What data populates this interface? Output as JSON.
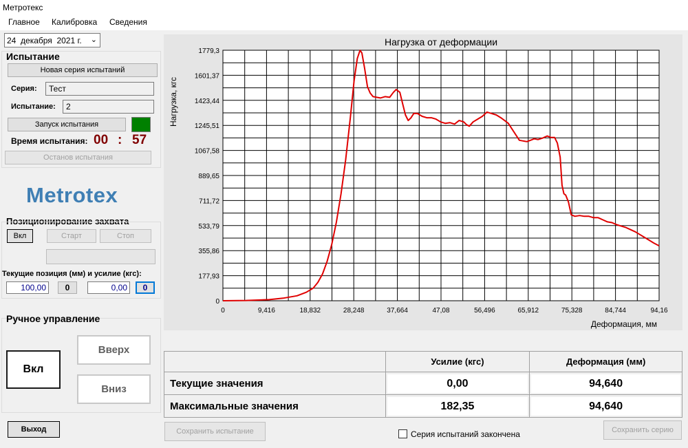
{
  "window": {
    "title": "Метротекс"
  },
  "menu": [
    "Главное",
    "Калибровка",
    "Сведения"
  ],
  "date": {
    "value": "24  декабря  2021 г."
  },
  "test": {
    "section_title": "Испытание",
    "new_series_button": "Новая серия испытаний",
    "series_label": "Серия:",
    "series_value": "Тест",
    "trial_label": "Испытание:",
    "trial_value": "2",
    "start_button": "Запуск испытания",
    "indicator_color": "#008000",
    "time_label": "Время испытания:",
    "time_minutes": "00",
    "time_sep": ":",
    "time_seconds": "57",
    "stop_button": "Останов испытания"
  },
  "logo": "Metrotex",
  "grip": {
    "section_title": "Позиционирование захвата",
    "on_button": "Вкл",
    "start_button": "Старт",
    "stop_button": "Стоп",
    "current_label": "Текущие позиция (мм) и усилие (кгс):",
    "position_value": "100,00",
    "position_zero": "0",
    "force_value": "0,00",
    "force_zero": "0"
  },
  "manual": {
    "section_title": "Ручное управление",
    "on_button": "Вкл",
    "up_button": "Вверх",
    "down_button": "Вниз"
  },
  "exit_button": "Выход",
  "save_test_button": "Сохранить испытание",
  "series_finished_label": "Серия испытаний закончена",
  "save_series_button": "Сохранить серию",
  "results": {
    "col_force": "Усилие (кгс)",
    "col_deform": "Деформация (мм)",
    "rows": [
      {
        "label": "Текущие значения",
        "force": "0,00",
        "deform": "94,640"
      },
      {
        "label": "Максимальные значения",
        "force": "182,35",
        "deform": "94,640"
      }
    ]
  },
  "chart_data": {
    "type": "line",
    "title": "Нагрузка от деформации",
    "xlabel": "Деформация, мм",
    "ylabel": "Нагрузка, кгс",
    "xlim": [
      0,
      94.16
    ],
    "ylim": [
      0,
      1779.3
    ],
    "x_ticks": [
      "0",
      "9,416",
      "18,832",
      "28,248",
      "37,664",
      "47,08",
      "56,496",
      "65,912",
      "75,328",
      "84,744",
      "94,16"
    ],
    "y_ticks": [
      "0",
      "177,93",
      "355,86",
      "533,79",
      "711,72",
      "889,65",
      "1067,58",
      "1245,51",
      "1423,44",
      "1601,37",
      "1779,3"
    ],
    "grid": true,
    "line_color": "#e00000",
    "series": [
      {
        "x": [
          0,
          5,
          10,
          13,
          16,
          18,
          19.5,
          20.5,
          21.5,
          22.5,
          23.5,
          24.5,
          25.5,
          26.5,
          27.5,
          28.3,
          29,
          29.6,
          30,
          30.6,
          31.2,
          31.8,
          32.4,
          33.2,
          34,
          35,
          36,
          36.8,
          37.4,
          38.2,
          38.8,
          39.4,
          40,
          40.6,
          41.2,
          42,
          43,
          44,
          45,
          46,
          47,
          48,
          49,
          50,
          51,
          52,
          52.6,
          53.2,
          54,
          55,
          56,
          57,
          58,
          59,
          60,
          60.8,
          61.6,
          62.4,
          63.2,
          64,
          64.8,
          65.6,
          66.4,
          67.2,
          68,
          69,
          70,
          70.8,
          71.6,
          72.2,
          72.8,
          73.2,
          73.6,
          74,
          74.6,
          75.2,
          76,
          77,
          78,
          79,
          80,
          81,
          82,
          83,
          84,
          85,
          86,
          87,
          88,
          89,
          90,
          91,
          92,
          93,
          94.16
        ],
        "y": [
          0,
          2,
          8,
          18,
          35,
          60,
          90,
          130,
          190,
          280,
          400,
          560,
          760,
          1000,
          1300,
          1560,
          1720,
          1779,
          1760,
          1650,
          1520,
          1475,
          1450,
          1445,
          1440,
          1450,
          1445,
          1480,
          1500,
          1480,
          1400,
          1320,
          1280,
          1300,
          1330,
          1330,
          1310,
          1300,
          1300,
          1290,
          1270,
          1260,
          1265,
          1255,
          1280,
          1270,
          1250,
          1240,
          1270,
          1290,
          1310,
          1340,
          1330,
          1320,
          1300,
          1280,
          1260,
          1220,
          1180,
          1140,
          1135,
          1130,
          1140,
          1150,
          1145,
          1155,
          1170,
          1160,
          1160,
          1120,
          1020,
          820,
          760,
          750,
          700,
          610,
          600,
          605,
          600,
          600,
          590,
          590,
          575,
          560,
          555,
          540,
          530,
          520,
          505,
          490,
          470,
          450,
          430,
          410,
          390
        ]
      }
    ]
  }
}
